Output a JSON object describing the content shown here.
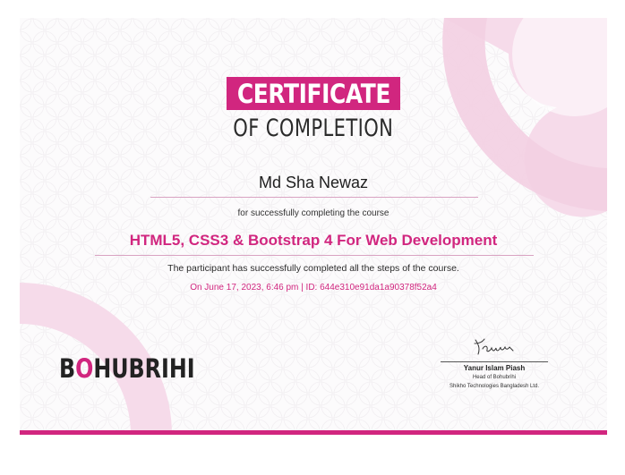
{
  "certificate": {
    "title": "CERTIFICATE",
    "subtitle": "OF COMPLETION",
    "recipient_name": "Md Sha Newaz",
    "intro_text": "for successfully completing the course",
    "course_title": "HTML5, CSS3 & Bootstrap 4 For Web Development",
    "completion_text": "The participant has successfully completed all the steps of the course.",
    "date_id": "On June 17, 2023, 6:46 pm | ID: 644e310e91da1a90378f52a4"
  },
  "branding": {
    "logo_text_prefix": "B",
    "logo_text_suffix": "HUBRIHI",
    "logo_icon": "o-with-dots-icon"
  },
  "signature": {
    "signature_image": "handwritten-signature",
    "name": "Yanur Islam Piash",
    "role": "Head of Bohubrihi",
    "company": "Shikho Technologies Bangladesh Ltd."
  },
  "colors": {
    "accent": "#d1267f",
    "decor": "#f6dbea",
    "text": "#222222"
  }
}
